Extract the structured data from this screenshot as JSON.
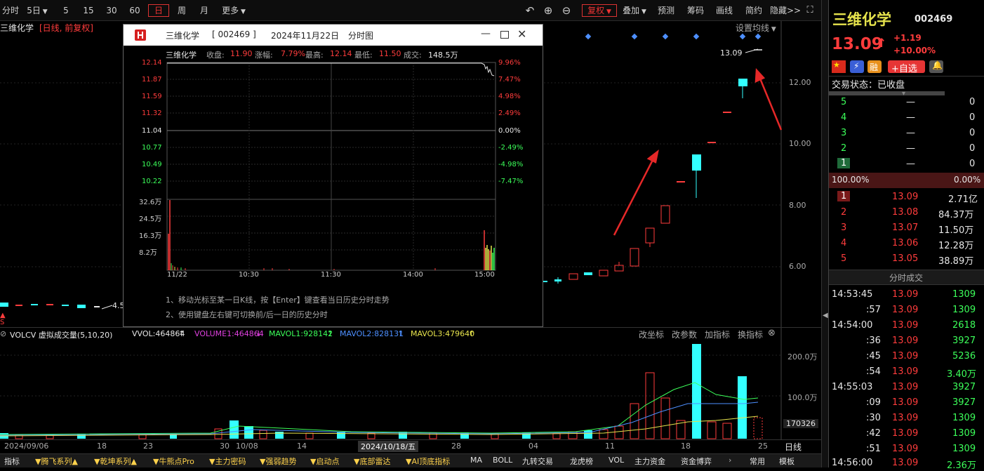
{
  "toolbar": {
    "periods": [
      "分时",
      "5日",
      "5",
      "15",
      "30",
      "60",
      "日",
      "周",
      "月",
      "更多"
    ],
    "active_period": "日",
    "fuquan": "复权",
    "overlay": "叠加",
    "forecast": "预测",
    "chips": "筹码",
    "draw": "画线",
    "simple": "简约",
    "hide": "隐藏>>"
  },
  "chart": {
    "stock_label": "三维化学",
    "mode_label": "[日线, 前复权]",
    "ma_setting": "设置均线",
    "last_price_tag": "13.09",
    "left_price_tag": "4.5",
    "price_axis": [
      "12.00",
      "10.00",
      "8.00",
      "6.00"
    ]
  },
  "volume": {
    "indicator": "VOLCV 虚拟成交量(5,10,20)",
    "vvol": "VVOL:464864",
    "volume1": "VOLUME1:464864",
    "mavol1": "MAVOL1:928142",
    "mavol2": "MAVOL2:828131",
    "mavol3": "MAVOL3:479640",
    "actions": [
      "改坐标",
      "改参数",
      "加指标",
      "换指标"
    ],
    "axis": [
      "200.0万",
      "100.0万"
    ],
    "current_value": "170326"
  },
  "date_axis": {
    "labels": [
      "2024/09/06",
      "18",
      "23",
      "30",
      "10/08",
      "14",
      "2024/10/18/五",
      "28",
      "04",
      "11",
      "18",
      "25"
    ],
    "period_label": "日线"
  },
  "bottom_bar": {
    "items": [
      "指标",
      "▼腾飞系列▲",
      "▼乾坤系列▲",
      "▼牛熊点Pro",
      "▼主力密码",
      "▼强弱趋势",
      "▼启动点",
      "▼底部雷达",
      "▼AI顶底指标",
      "MA",
      "BOLL",
      "九转交易",
      "龙虎榜",
      "VOL",
      "主力资金",
      "资金博弈"
    ],
    "right_items": [
      "常用",
      "模板"
    ]
  },
  "popup": {
    "title_name": "三维化学",
    "title_code": "[ 002469 ]",
    "title_date": "2024年11月22日",
    "title_type": "分时图",
    "info_name": "三维化学",
    "info_close_label": "收盘:",
    "info_close": "11.90",
    "info_chg_label": "涨幅:",
    "info_chg": "7.79%",
    "info_high_label": "最高:",
    "info_high": "12.14",
    "info_low_label": "最低:",
    "info_low": "11.50",
    "info_vol_label": "成交:",
    "info_vol": "148.5万",
    "left_axis_red": [
      "12.14",
      "11.87",
      "11.59",
      "11.32"
    ],
    "left_axis_mid": "11.04",
    "left_axis_green": [
      "10.77",
      "10.49",
      "10.22"
    ],
    "right_axis_red": [
      "9.96%",
      "7.47%",
      "4.98%",
      "2.49%"
    ],
    "right_axis_mid": "0.00%",
    "right_axis_green": [
      "-2.49%",
      "-4.98%",
      "-7.47%"
    ],
    "vol_axis": [
      "32.6万",
      "24.5万",
      "16.3万",
      "8.2万"
    ],
    "time_axis": [
      "11/22",
      "10:30",
      "11:30",
      "14:00",
      "15:00"
    ],
    "hint1": "1、移动光标至某一日K线，按【Enter】键查看当日历史分时走势",
    "hint2": "2、使用键盘左右键可切换前/后一日的历史分时"
  },
  "quote": {
    "name": "三维化学",
    "code": "002469",
    "price": "13.09",
    "arrow": "↑",
    "change": "+1.19",
    "pct": "+10.00%",
    "tags": [
      "融",
      "+自选"
    ],
    "status": "交易状态：已收盘",
    "ask_rows": [
      {
        "lvl": "5",
        "price": "—",
        "vol": "0"
      },
      {
        "lvl": "4",
        "price": "—",
        "vol": "0"
      },
      {
        "lvl": "3",
        "price": "—",
        "vol": "0"
      },
      {
        "lvl": "2",
        "price": "—",
        "vol": "0"
      },
      {
        "lvl": "1",
        "price": "—",
        "vol": "0"
      }
    ],
    "ratio_left": "100.00%",
    "ratio_right": "0.00%",
    "bid_rows": [
      {
        "lvl": "1",
        "price": "13.09",
        "vol": "2.71亿"
      },
      {
        "lvl": "2",
        "price": "13.08",
        "vol": "84.37万"
      },
      {
        "lvl": "3",
        "price": "13.07",
        "vol": "11.50万"
      },
      {
        "lvl": "4",
        "price": "13.06",
        "vol": "12.28万"
      },
      {
        "lvl": "5",
        "price": "13.05",
        "vol": "38.89万"
      }
    ],
    "ticks_title": "分时成交",
    "ticks": [
      {
        "time": "14:53:45",
        "price": "13.09",
        "vol": "1309"
      },
      {
        "time": ":57",
        "price": "13.09",
        "vol": "1309"
      },
      {
        "time": "14:54:00",
        "price": "13.09",
        "vol": "2618"
      },
      {
        "time": ":36",
        "price": "13.09",
        "vol": "3927"
      },
      {
        "time": ":45",
        "price": "13.09",
        "vol": "5236"
      },
      {
        "time": ":54",
        "price": "13.09",
        "vol": "3.40万"
      },
      {
        "time": "14:55:03",
        "price": "13.09",
        "vol": "3927"
      },
      {
        "time": ":09",
        "price": "13.09",
        "vol": "3927"
      },
      {
        "time": ":30",
        "price": "13.09",
        "vol": "1309"
      },
      {
        "time": ":42",
        "price": "13.09",
        "vol": "1309"
      },
      {
        "time": ":51",
        "price": "13.09",
        "vol": "1309"
      },
      {
        "time": "14:56:00",
        "price": "13.09",
        "vol": "2.36万"
      }
    ]
  },
  "colors": {
    "up": "#ff3c3c",
    "down": "#3cff5a",
    "cyan": "#33ffff"
  }
}
